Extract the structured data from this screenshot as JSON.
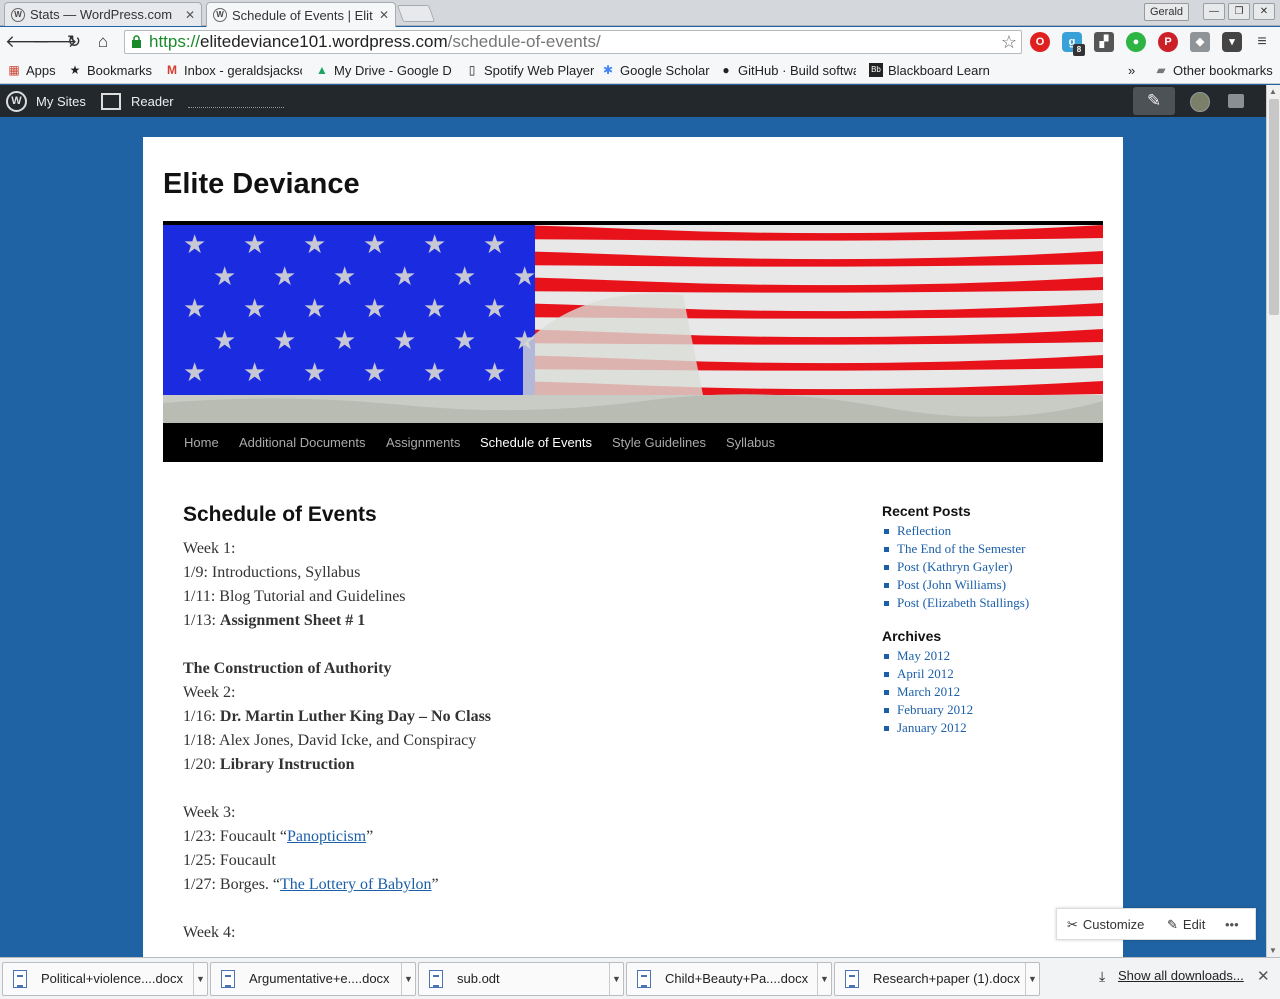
{
  "browser": {
    "tabs": [
      {
        "label": "Stats — WordPress.com"
      },
      {
        "label": "Schedule of Events | Elite Deviance"
      }
    ],
    "profile": "Gerald",
    "url_scheme": "https://",
    "url_host": "elitedeviance101.wordpress.com",
    "url_path": "/schedule-of-events/",
    "extension_badge": "8",
    "bookmarks": [
      "Apps",
      "Bookmarks",
      "Inbox - geraldsjackso",
      "My Drive - Google Dr",
      "Spotify Web Player",
      "Google Scholar",
      "GitHub · Build softwa",
      "Blackboard Learn"
    ],
    "bookmarks_overflow": "»",
    "other_bookmarks": "Other bookmarks"
  },
  "adminbar": {
    "my_sites": "My Sites",
    "reader": "Reader"
  },
  "site": {
    "title": "Elite Deviance",
    "nav": [
      "Home",
      "Additional Documents",
      "Assignments",
      "Schedule of Events",
      "Style Guidelines",
      "Syllabus"
    ],
    "current_nav": "Schedule of Events"
  },
  "entry": {
    "title": "Schedule of Events",
    "week1": "Week 1:",
    "l1": "1/9: Introductions, Syllabus",
    "l2": "1/11: Blog Tutorial and Guidelines",
    "l3_pre": "1/13: ",
    "l3_bold": "Assignment Sheet # 1",
    "section": "The Construction of Authority",
    "week2": "Week 2:",
    "l4_pre": "1/16: ",
    "l4_bold": "Dr. Martin Luther King Day – No Class",
    "l5": "1/18: Alex Jones, David Icke, and Conspiracy",
    "l6_pre": "1/20: ",
    "l6_bold": "Library Instruction",
    "week3": "Week 3:",
    "l7_pre": "1/23: Foucault “",
    "l7_link": "Panopticism",
    "l7_post": "”",
    "l8": "1/25: Foucault",
    "l9_pre": "1/27: Borges. “",
    "l9_link": "The Lottery of Babylon",
    "l9_post": "”",
    "week4": "Week 4:"
  },
  "sidebar": {
    "recent_title": "Recent Posts",
    "recent": [
      "Reflection",
      "The End of the Semester",
      "Post (Kathryn Gayler)",
      "Post (John Williams)",
      "Post (Elizabeth Stallings)"
    ],
    "archives_title": "Archives",
    "archives": [
      "May 2012",
      "April 2012",
      "March 2012",
      "February 2012",
      "January 2012"
    ]
  },
  "customize_bar": {
    "customize": "Customize",
    "edit": "Edit",
    "more": "•••"
  },
  "downloads": {
    "files": [
      "Political+violence....docx",
      "Argumentative+e....docx",
      "sub.odt",
      "Child+Beauty+Pa....docx",
      "Research+paper (1).docx"
    ],
    "show_all": "Show all downloads..."
  },
  "colors": {
    "page_bg": "#2063a4",
    "admin_bar": "#23282d",
    "nav_bg": "#000000",
    "link": "#1b5fa8"
  }
}
